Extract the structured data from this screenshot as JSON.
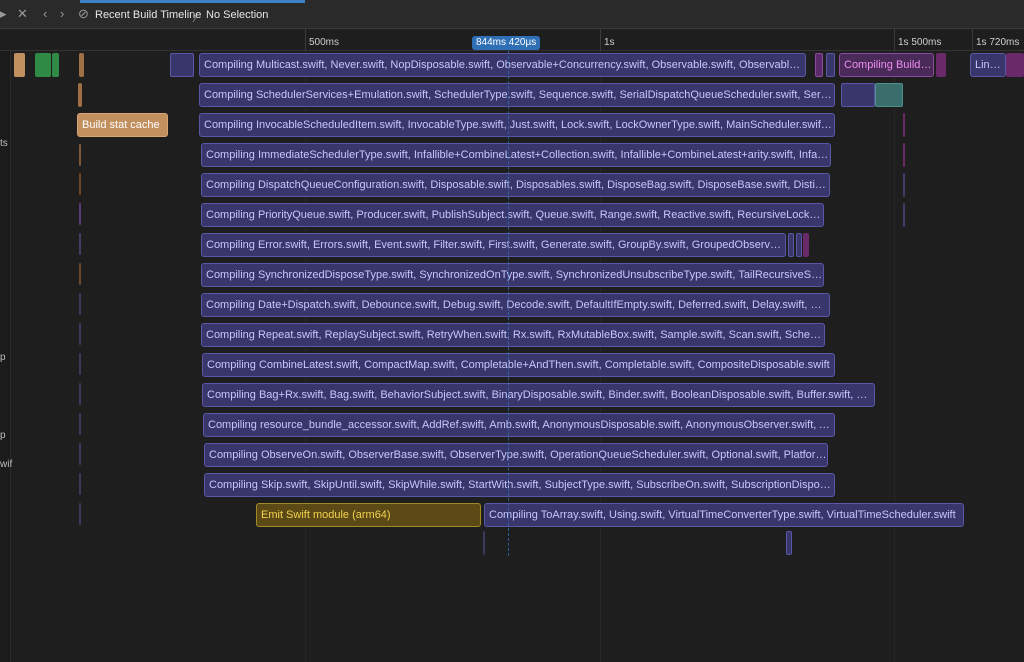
{
  "toolbar": {
    "window_title": "Recent Build Timeline",
    "selection": "No Selection",
    "separator": "〉"
  },
  "ruler": {
    "ticks": [
      "500ms",
      "1s",
      "1s 500ms",
      "1s 720ms"
    ],
    "cursor_time": "844ms 420µs"
  },
  "sidebar_fragments": [
    "ts",
    "p",
    "p",
    "wif"
  ],
  "lanes": {
    "row1": {
      "main": "Compiling Multicast.swift, Never.swift, NopDisposable.swift, Observable+Concurrency.swift, Observable.swift, ObservableType.swift",
      "pink": "Compiling BuildTask.swift",
      "link": "Linking RxSwift"
    },
    "row2": {
      "main": "Compiling SchedulerServices+Emulation.swift, SchedulerType.swift, Sequence.swift, SerialDispatchQueueScheduler.swift, SerialDisposable.swift"
    },
    "row3": {
      "main": "Compiling InvocableScheduledItem.swift, InvocableType.swift, Just.swift, Lock.swift, LockOwnerType.swift, MainScheduler.swift, Map.swift",
      "tan": "Build stat cache"
    },
    "row4": {
      "main": "Compiling ImmediateSchedulerType.swift, Infallible+CombineLatest+Collection.swift, Infallible+CombineLatest+arity.swift, Infallible.swift"
    },
    "row5": {
      "main": "Compiling DispatchQueueConfiguration.swift, Disposable.swift, Disposables.swift, DisposeBag.swift, DisposeBase.swift, DistinctUntilChanged.swift"
    },
    "row6": {
      "main": "Compiling PriorityQueue.swift, Producer.swift, PublishSubject.swift, Queue.swift, Range.swift, Reactive.swift, RecursiveLock.swift"
    },
    "row7": {
      "main": "Compiling Error.swift, Errors.swift, Event.swift, Filter.swift, First.swift, Generate.swift, GroupBy.swift, GroupedObservable.swift"
    },
    "row8": {
      "main": "Compiling SynchronizedDisposeType.swift, SynchronizedOnType.swift, SynchronizedUnsubscribeType.swift, TailRecursiveSink.swift"
    },
    "row9": {
      "main": "Compiling Date+Dispatch.swift, Debounce.swift, Debug.swift, Decode.swift, DefaultIfEmpty.swift, Deferred.swift, Delay.swift, Delaysubscription.swift"
    },
    "row10": {
      "main": "Compiling Repeat.swift, ReplaySubject.swift, RetryWhen.swift, Rx.swift, RxMutableBox.swift, Sample.swift, Scan.swift, ScheduledDisposable.swift"
    },
    "row11": {
      "main": "Compiling CombineLatest.swift, CompactMap.swift, Completable+AndThen.swift, Completable.swift, CompositeDisposable.swift"
    },
    "row12": {
      "main": "Compiling Bag+Rx.swift, Bag.swift, BehaviorSubject.swift, BinaryDisposable.swift, Binder.swift, BooleanDisposable.swift, Buffer.swift, Cancelable.swift"
    },
    "row13": {
      "main": "Compiling resource_bundle_accessor.swift, AddRef.swift, Amb.swift, AnonymousDisposable.swift, AnonymousObserver.swift, AsMaybe.swift"
    },
    "row14": {
      "main": "Compiling ObserveOn.swift, ObserverBase.swift, ObserverType.swift, OperationQueueScheduler.swift, Optional.swift, Platform.Darwin.swift"
    },
    "row15": {
      "main": "Compiling Skip.swift, SkipUntil.swift, SkipWhile.swift, StartWith.swift, SubjectType.swift, SubscribeOn.swift, SubscriptionDisposable.swift"
    },
    "row16": {
      "emit": "Emit Swift module (arm64)",
      "main": "Compiling ToArray.swift, Using.swift, VirtualTimeConverterType.swift, VirtualTimeScheduler.swift"
    }
  },
  "colors": {
    "compile": "#38366a",
    "emit": "#5b4a16",
    "cache": "#c28f5e",
    "accent": "#2f6fb6",
    "green": "#2f8a45",
    "teal": "#3a6e6c"
  }
}
